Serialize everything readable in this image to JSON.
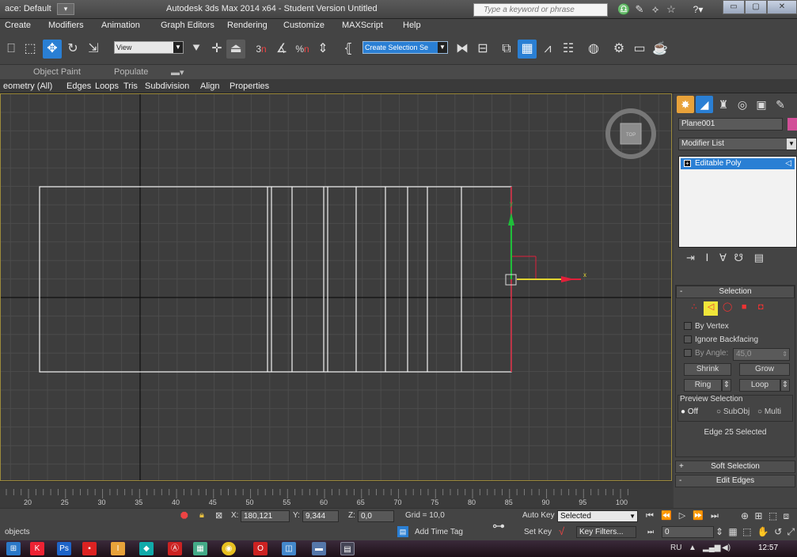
{
  "titlebar": {
    "workspace_label": "ace: Default",
    "window_title": "Autodesk 3ds Max  2014 x64  - Student Version   Untitled",
    "search_placeholder": "Type a keyword or phrase",
    "help_label": "?"
  },
  "menubar": {
    "items": [
      "Create",
      "Modifiers",
      "Animation",
      "Graph Editors",
      "Rendering",
      "Customize",
      "MAXScript",
      "Help"
    ]
  },
  "toolbar": {
    "ref_coord_value": "View",
    "selection_set_value": "Create Selection Se",
    "snap_numbers": [
      "3",
      "%",
      "n"
    ]
  },
  "ribbon": {
    "tabs": [
      "Object Paint",
      "Populate"
    ],
    "sub_tabs": [
      "eometry (All)",
      "Edges",
      "Loops",
      "Tris",
      "Subdivision",
      "Align",
      "Properties"
    ]
  },
  "viewport": {
    "viewcube_label": "TOP",
    "axis_x_label": "x",
    "axis_y_label": "y"
  },
  "command_panel": {
    "object_name": "Plane001",
    "object_color": "#d24f98",
    "modifier_list_label": "Modifier List",
    "stack_item": "Editable Poly",
    "selection_rollout": "Selection",
    "by_vertex": "By Vertex",
    "ignore_backfacing": "Ignore Backfacing",
    "by_angle_label": "By Angle:",
    "by_angle_value": "45,0",
    "shrink": "Shrink",
    "grow": "Grow",
    "ring": "Ring",
    "loop": "Loop",
    "preview_selection": "Preview Selection",
    "preview_off": "Off",
    "preview_subobj": "SubObj",
    "preview_multi": "Multi",
    "selection_status": "Edge 25 Selected",
    "soft_selection": "Soft Selection",
    "edit_edges": "Edit Edges"
  },
  "timeline": {
    "tick_labels": [
      "20",
      "25",
      "30",
      "35",
      "40",
      "45",
      "50",
      "55",
      "60",
      "65",
      "70",
      "75",
      "80",
      "85",
      "90",
      "95",
      "100"
    ]
  },
  "statusbar": {
    "status_text": "objects",
    "x_label": "X:",
    "x_value": "180,121",
    "y_label": "Y:",
    "y_value": "9,344",
    "z_label": "Z:",
    "z_value": "0,0",
    "grid": "Grid = 10,0",
    "add_time_tag": "Add Time Tag",
    "auto_key": "Auto Key",
    "set_key": "Set Key",
    "key_mode_value": "Selected",
    "key_filters": "Key Filters...",
    "frame_value": "0"
  },
  "taskbar": {
    "language": "RU",
    "time": "12:57"
  },
  "colors": {
    "accent_blue": "#2a7fd4",
    "viewport_border": "#9c8a3c",
    "selected_edge": "#e0203a",
    "axis_y": "#1fbf3a",
    "axis_x": "#e0d430"
  }
}
